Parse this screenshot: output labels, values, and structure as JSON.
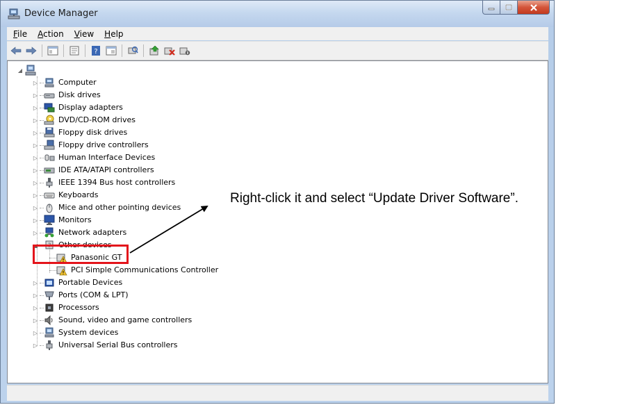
{
  "window": {
    "title": "Device Manager",
    "menu": [
      {
        "key": "F",
        "rest": "ile"
      },
      {
        "key": "A",
        "rest": "ction"
      },
      {
        "key": "V",
        "rest": "iew"
      },
      {
        "key": "H",
        "rest": "elp"
      }
    ]
  },
  "toolbar": {
    "buttons": [
      "back-icon",
      "forward-icon",
      "properties-icon",
      "show-hide-tree-icon",
      "help-icon",
      "view-icon",
      "scan-hardware-icon",
      "update-driver-icon",
      "uninstall-icon",
      "disable-icon"
    ]
  },
  "tree": {
    "root_label": "",
    "items": [
      {
        "label": "Computer",
        "icon": "computer-icon"
      },
      {
        "label": "Disk drives",
        "icon": "disk-drive-icon"
      },
      {
        "label": "Display adapters",
        "icon": "display-adapter-icon"
      },
      {
        "label": "DVD/CD-ROM drives",
        "icon": "dvd-drive-icon"
      },
      {
        "label": "Floppy disk drives",
        "icon": "floppy-drive-icon"
      },
      {
        "label": "Floppy drive controllers",
        "icon": "floppy-controller-icon"
      },
      {
        "label": "Human Interface Devices",
        "icon": "hid-icon"
      },
      {
        "label": "IDE ATA/ATAPI controllers",
        "icon": "ide-controller-icon"
      },
      {
        "label": "IEEE 1394 Bus host controllers",
        "icon": "ieee1394-icon"
      },
      {
        "label": "Keyboards",
        "icon": "keyboard-icon"
      },
      {
        "label": "Mice and other pointing devices",
        "icon": "mouse-icon"
      },
      {
        "label": "Monitors",
        "icon": "monitor-icon"
      },
      {
        "label": "Network adapters",
        "icon": "network-adapter-icon"
      },
      {
        "label": "Other devices",
        "icon": "other-devices-icon",
        "expanded": true
      },
      {
        "label": "Panasonic GT",
        "icon": "warning-device-icon",
        "child": true
      },
      {
        "label": "PCI Simple Communications Controller",
        "icon": "warning-device-icon",
        "child": true
      },
      {
        "label": "Portable Devices",
        "icon": "portable-device-icon"
      },
      {
        "label": "Ports (COM & LPT)",
        "icon": "port-icon"
      },
      {
        "label": "Processors",
        "icon": "processor-icon"
      },
      {
        "label": "Sound, video and game controllers",
        "icon": "sound-icon"
      },
      {
        "label": "System devices",
        "icon": "system-devices-icon"
      },
      {
        "label": "Universal Serial Bus controllers",
        "icon": "usb-icon"
      }
    ]
  },
  "annotation": {
    "text": "Right-click it and select “Update Driver Software”."
  },
  "colors": {
    "highlight": "#e3141b",
    "warning": "#f2c230"
  }
}
